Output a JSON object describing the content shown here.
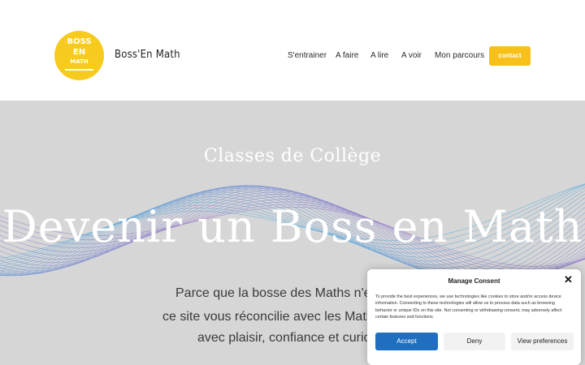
{
  "header": {
    "logo": {
      "line1": "BOSS",
      "line2": "EN",
      "line3": "MATH"
    },
    "site_title": "Boss'En Math",
    "nav": [
      {
        "label": "S'entrainer"
      },
      {
        "label": "A faire"
      },
      {
        "label": "A lire"
      },
      {
        "label": "A voir"
      },
      {
        "label": "Mon parcours"
      }
    ],
    "contact_label": "contact"
  },
  "hero": {
    "subtitle": "Classes de Collège",
    "title": "Devenir un Boss en Math",
    "lines": [
      "Parce que la bosse des Maths n'exi",
      "ce site vous réconcilie avec les Mathé",
      "avec plaisir, confiance et curios"
    ]
  },
  "consent": {
    "title": "Manage Consent",
    "close_label": "✕",
    "text": "To provide the best experiences, we use technologies like cookies to store and/or access device information. Consenting to these technologies will allow us to process data such as browsing behavior or unique IDs on this site. Not consenting or withdrawing consent, may adversely affect certain features and functions.",
    "accept_label": "Accept",
    "deny_label": "Deny",
    "preferences_label": "View preferences"
  },
  "colors": {
    "accent_yellow": "#f7c11a",
    "accept_blue": "#1f6fbe",
    "hero_bg": "#d6d6d6"
  }
}
